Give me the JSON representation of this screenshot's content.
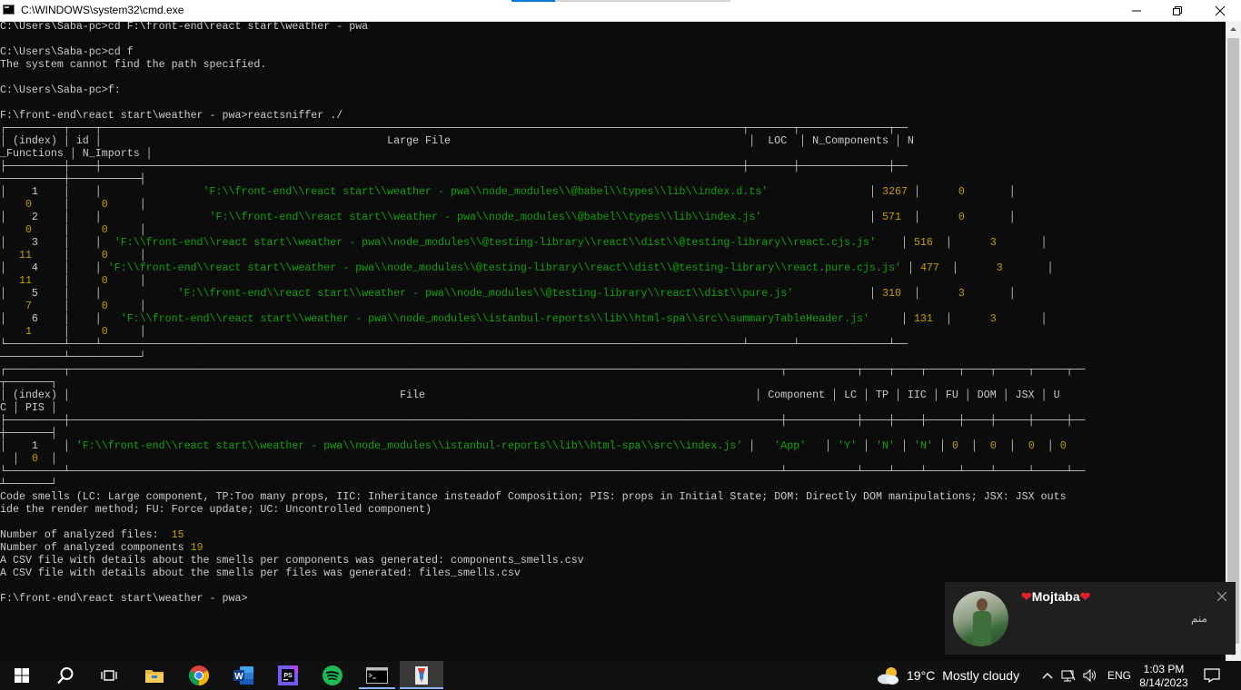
{
  "window": {
    "title": "C:\\WINDOWS\\system32\\cmd.exe"
  },
  "console": {
    "lines": [
      {
        "segs": [
          {
            "t": "C:\\Users\\Saba-pc>cd F:\\front-end\\react start\\weather - pwa"
          }
        ]
      },
      {
        "segs": [
          {
            "t": ""
          }
        ]
      },
      {
        "segs": [
          {
            "t": "C:\\Users\\Saba-pc>cd f"
          }
        ]
      },
      {
        "segs": [
          {
            "t": "The system cannot find the path specified."
          }
        ]
      },
      {
        "segs": [
          {
            "t": ""
          }
        ]
      },
      {
        "segs": [
          {
            "t": "C:\\Users\\Saba-pc>f:"
          }
        ]
      },
      {
        "segs": [
          {
            "t": ""
          }
        ]
      },
      {
        "segs": [
          {
            "t": "F:\\front-end\\react start\\weather - pwa>reactsniffer ./"
          }
        ]
      },
      {
        "segs": [
          {
            "t": "┌─────────┬────┬─────────────────────────────────────────────────────────────────────────────────────────────────────┬───────┬──────────────┬──"
          }
        ]
      },
      {
        "segs": [
          {
            "t": "│ (index) │ id │                                             Large File                                               │  LOC  │ N_Components │ N"
          }
        ]
      },
      {
        "segs": [
          {
            "t": "_Functions │ N_Imports │"
          }
        ]
      },
      {
        "segs": [
          {
            "t": "├─────────┼────┼─────────────────────────────────────────────────────────────────────────────────────────────────────┼───────┼──────────────┼──"
          }
        ]
      },
      {
        "segs": [
          {
            "t": "──────────┼───────────┤"
          }
        ]
      },
      {
        "segs": [
          {
            "t": "│    1    │    │                "
          },
          {
            "t": "'F:\\\\front-end\\\\react start\\\\weather - pwa\\\\node_modules\\\\@babel\\\\types\\\\lib\\\\index.d.ts'",
            "c": "g"
          },
          {
            "t": "                │ "
          },
          {
            "t": "3267",
            "c": "y"
          },
          {
            "t": " │      "
          },
          {
            "t": "0",
            "c": "y"
          },
          {
            "t": "       │"
          }
        ]
      },
      {
        "segs": [
          {
            "t": "    "
          },
          {
            "t": "0",
            "c": "y"
          },
          {
            "t": "     │     "
          },
          {
            "t": "0",
            "c": "y"
          },
          {
            "t": "     │"
          }
        ]
      },
      {
        "segs": [
          {
            "t": "│    2    │    │                 "
          },
          {
            "t": "'F:\\\\front-end\\\\react start\\\\weather - pwa\\\\node_modules\\\\@babel\\\\types\\\\lib\\\\index.js'",
            "c": "g"
          },
          {
            "t": "                 │ "
          },
          {
            "t": "571",
            "c": "y"
          },
          {
            "t": "  │      "
          },
          {
            "t": "0",
            "c": "y"
          },
          {
            "t": "       │"
          }
        ]
      },
      {
        "segs": [
          {
            "t": "    "
          },
          {
            "t": "0",
            "c": "y"
          },
          {
            "t": "     │     "
          },
          {
            "t": "0",
            "c": "y"
          },
          {
            "t": "     │"
          }
        ]
      },
      {
        "segs": [
          {
            "t": "│    3    │    │  "
          },
          {
            "t": "'F:\\\\front-end\\\\react start\\\\weather - pwa\\\\node_modules\\\\@testing-library\\\\react\\\\dist\\\\@testing-library\\\\react.cjs.js'",
            "c": "g"
          },
          {
            "t": "    │ "
          },
          {
            "t": "516",
            "c": "y"
          },
          {
            "t": "  │      "
          },
          {
            "t": "3",
            "c": "y"
          },
          {
            "t": "       │"
          }
        ]
      },
      {
        "segs": [
          {
            "t": "   "
          },
          {
            "t": "11",
            "c": "y"
          },
          {
            "t": "     │     "
          },
          {
            "t": "0",
            "c": "y"
          },
          {
            "t": "     │"
          }
        ]
      },
      {
        "segs": [
          {
            "t": "│    4    │    │ "
          },
          {
            "t": "'F:\\\\front-end\\\\react start\\\\weather - pwa\\\\node_modules\\\\@testing-library\\\\react\\\\dist\\\\@testing-library\\\\react.pure.cjs.js'",
            "c": "g"
          },
          {
            "t": " │ "
          },
          {
            "t": "477",
            "c": "y"
          },
          {
            "t": "  │      "
          },
          {
            "t": "3",
            "c": "y"
          },
          {
            "t": "       │"
          }
        ]
      },
      {
        "segs": [
          {
            "t": "   "
          },
          {
            "t": "11",
            "c": "y"
          },
          {
            "t": "     │     "
          },
          {
            "t": "0",
            "c": "y"
          },
          {
            "t": "     │"
          }
        ]
      },
      {
        "segs": [
          {
            "t": "│    5    │    │            "
          },
          {
            "t": "'F:\\\\front-end\\\\react start\\\\weather - pwa\\\\node_modules\\\\@testing-library\\\\react\\\\dist\\\\pure.js'",
            "c": "g"
          },
          {
            "t": "            │ "
          },
          {
            "t": "310",
            "c": "y"
          },
          {
            "t": "  │      "
          },
          {
            "t": "3",
            "c": "y"
          },
          {
            "t": "       │"
          }
        ]
      },
      {
        "segs": [
          {
            "t": "    "
          },
          {
            "t": "7",
            "c": "y"
          },
          {
            "t": "     │     "
          },
          {
            "t": "0",
            "c": "y"
          },
          {
            "t": "     │"
          }
        ]
      },
      {
        "segs": [
          {
            "t": "│    6    │    │   "
          },
          {
            "t": "'F:\\\\front-end\\\\react start\\\\weather - pwa\\\\node_modules\\\\istanbul-reports\\\\lib\\\\html-spa\\\\src\\\\summaryTableHeader.js'",
            "c": "g"
          },
          {
            "t": "     │ "
          },
          {
            "t": "131",
            "c": "y"
          },
          {
            "t": "  │      "
          },
          {
            "t": "3",
            "c": "y"
          },
          {
            "t": "       │"
          }
        ]
      },
      {
        "segs": [
          {
            "t": "    "
          },
          {
            "t": "1",
            "c": "y"
          },
          {
            "t": "     │     "
          },
          {
            "t": "0",
            "c": "y"
          },
          {
            "t": "     │"
          }
        ]
      },
      {
        "segs": [
          {
            "t": "└─────────┴────┴─────────────────────────────────────────────────────────────────────────────────────────────────────┴───────┴──────────────┴──"
          }
        ]
      },
      {
        "segs": [
          {
            "t": "──────────┴───────────┘"
          }
        ]
      },
      {
        "segs": [
          {
            "t": "┌─────────┬────────────────────────────────────────────────────────────────────────────────────────────────────────────────┬───────────┬────┬────┬─────┬────┬─────┬─────┬──"
          }
        ]
      },
      {
        "segs": [
          {
            "t": "┬───────┐"
          }
        ]
      },
      {
        "segs": [
          {
            "t": "│ (index) │                                                    File                                                    │ Component │ LC │ TP │ IIC │ FU │ DOM │ JSX │ U"
          }
        ]
      },
      {
        "segs": [
          {
            "t": "C │ PIS │"
          }
        ]
      },
      {
        "segs": [
          {
            "t": "├─────────┼────────────────────────────────────────────────────────────────────────────────────────────────────────────────┼───────────┼────┼────┼─────┼────┼─────┼─────┼──"
          }
        ]
      },
      {
        "segs": [
          {
            "t": "┼───────┤"
          }
        ]
      },
      {
        "segs": [
          {
            "t": "│    1    │ "
          },
          {
            "t": "'F:\\\\front-end\\\\react start\\\\weather - pwa\\\\node_modules\\\\istanbul-reports\\\\lib\\\\html-spa\\\\src\\\\index.js'",
            "c": "g"
          },
          {
            "t": " │   "
          },
          {
            "t": "'App'",
            "c": "g"
          },
          {
            "t": "   │ "
          },
          {
            "t": "'Y'",
            "c": "g"
          },
          {
            "t": " │ "
          },
          {
            "t": "'N'",
            "c": "g"
          },
          {
            "t": " │ "
          },
          {
            "t": "'N'",
            "c": "g"
          },
          {
            "t": " │ "
          },
          {
            "t": "0",
            "c": "y"
          },
          {
            "t": "  │  "
          },
          {
            "t": "0",
            "c": "y"
          },
          {
            "t": "  │  "
          },
          {
            "t": "0",
            "c": "y"
          },
          {
            "t": "  │ "
          },
          {
            "t": "0",
            "c": "y"
          }
        ]
      },
      {
        "segs": [
          {
            "t": "  │  "
          },
          {
            "t": "0",
            "c": "y"
          },
          {
            "t": "  │"
          }
        ]
      },
      {
        "segs": [
          {
            "t": "└─────────┴────────────────────────────────────────────────────────────────────────────────────────────────────────────────┴───────────┴────┴────┴─────┴────┴─────┴─────┴──"
          }
        ]
      },
      {
        "segs": [
          {
            "t": "┴───────┘"
          }
        ]
      },
      {
        "segs": [
          {
            "t": "Code smells (LC: Large component, TP:Too many props, IIC: Inheritance insteadof Composition; PIS: props in Initial State; DOM: Directly DOM manipulations; JSX: JSX outs"
          }
        ]
      },
      {
        "segs": [
          {
            "t": "ide the render method; FU: Force update; UC: Uncontrolled component)"
          }
        ]
      },
      {
        "segs": [
          {
            "t": ""
          }
        ]
      },
      {
        "segs": [
          {
            "t": "Number of analyzed files:  "
          },
          {
            "t": "15",
            "c": "y"
          }
        ]
      },
      {
        "segs": [
          {
            "t": "Number of analyzed components "
          },
          {
            "t": "19",
            "c": "y"
          }
        ]
      },
      {
        "segs": [
          {
            "t": "A CSV file with details about the smells per components was generated: components_smells.csv"
          }
        ]
      },
      {
        "segs": [
          {
            "t": "A CSV file with details about the smells per files was generated: files_smells.csv"
          }
        ]
      },
      {
        "segs": [
          {
            "t": ""
          }
        ]
      },
      {
        "segs": [
          {
            "t": "F:\\front-end\\react start\\weather - pwa>"
          }
        ]
      }
    ]
  },
  "notification": {
    "name": "Mojtaba",
    "heart": "❤",
    "message": "منم"
  },
  "taskbar": {
    "weather_temp": "19°C",
    "weather_desc": "Mostly cloudy",
    "language": "ENG",
    "time": "1:03 PM",
    "date": "8/14/2023",
    "apps": [
      "start",
      "search",
      "task-view",
      "file-explorer",
      "chrome",
      "word",
      "phpstorm",
      "spotify",
      "cmd",
      "git"
    ]
  },
  "colors": {
    "console_bg": "#0c0c0c",
    "console_fg": "#cccccc",
    "string_green": "#13a10e",
    "number_yellow": "#c19c00",
    "accent": "#0078d7"
  }
}
